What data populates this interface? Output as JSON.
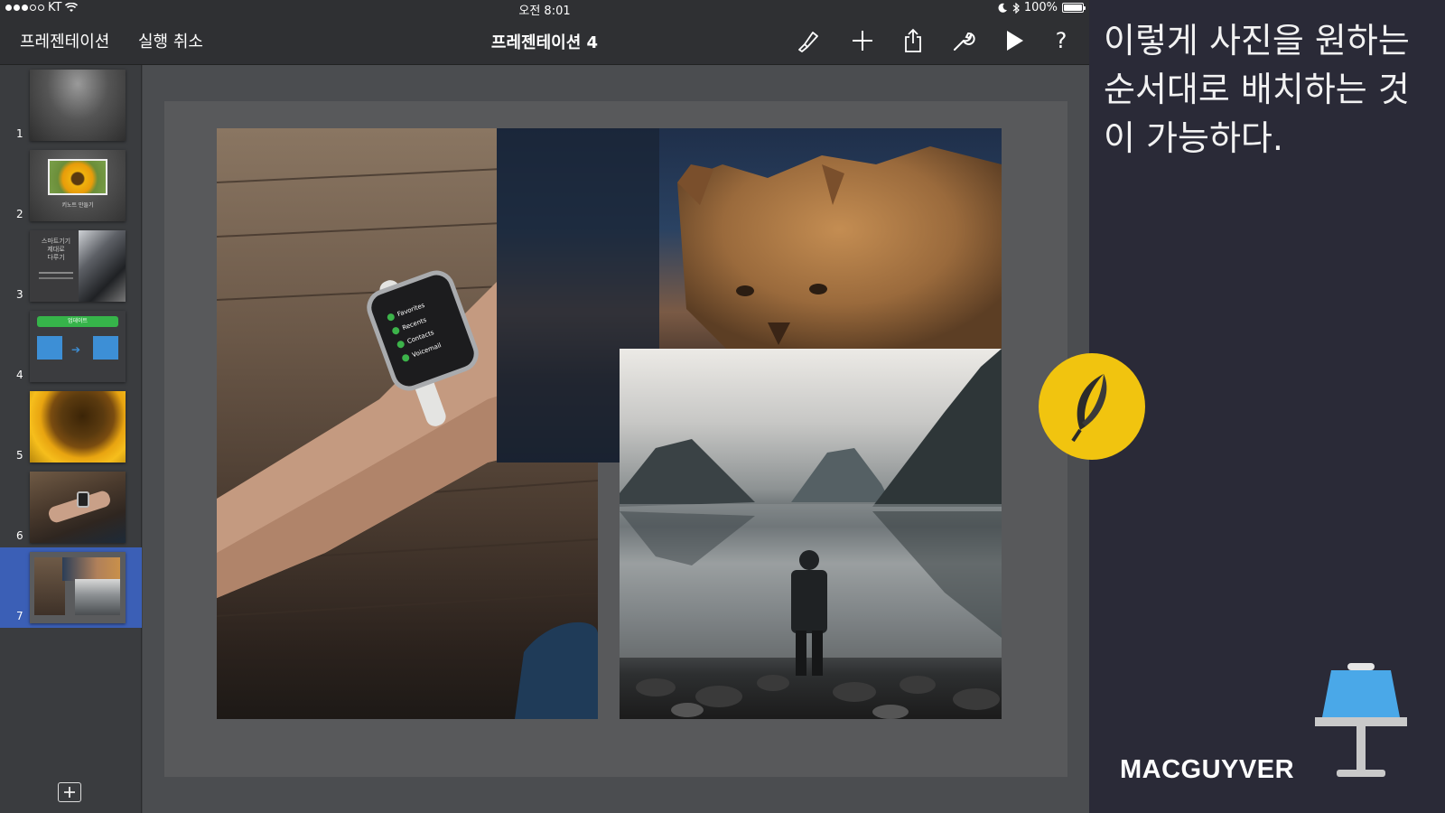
{
  "status_bar": {
    "carrier": "KT",
    "time": "오전 8:01",
    "battery_percent": "100%"
  },
  "toolbar": {
    "presentations_label": "프레젠테이션",
    "undo_label": "실행 취소",
    "document_title": "프레젠테이션 4",
    "icons": [
      "brush-icon",
      "plus-icon",
      "share-icon",
      "wrench-icon",
      "play-icon",
      "help-icon"
    ],
    "help_glyph": "?"
  },
  "sidebar": {
    "selected_slide": 7,
    "slides": [
      {
        "number": "1"
      },
      {
        "number": "2",
        "caption": "키노트 만들기"
      },
      {
        "number": "3",
        "title_lines": [
          "스마트기기",
          "제대로",
          "다루기"
        ]
      },
      {
        "number": "4",
        "banner": "업데이트"
      },
      {
        "number": "5"
      },
      {
        "number": "6"
      },
      {
        "number": "7"
      }
    ]
  },
  "watch_screen": {
    "menu": [
      "Favorites",
      "Recents",
      "Contacts",
      "Voicemail"
    ]
  },
  "overlay": {
    "caption": "이렇게 사진을 원하는 순서대로 배치하는 것이 가능하다.",
    "brand": "MACGUYVER",
    "accent_color": "#f1c40f"
  }
}
